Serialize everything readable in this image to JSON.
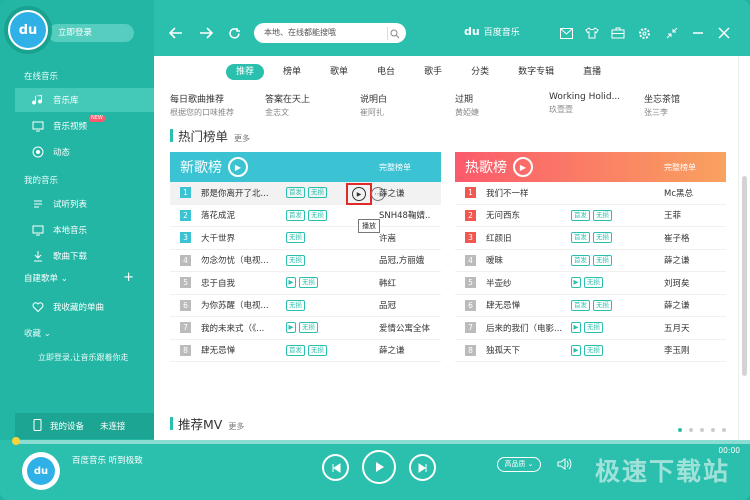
{
  "sidebar": {
    "login": "立即登录",
    "online_section": "在线音乐",
    "items": [
      {
        "label": "音乐库",
        "icon": "music-note-icon"
      },
      {
        "label": "音乐视频",
        "icon": "video-icon",
        "badge": "NEW"
      },
      {
        "label": "动态",
        "icon": "activity-icon"
      }
    ],
    "my_section": "我的音乐",
    "my_items": [
      {
        "label": "试听列表",
        "icon": "list-icon"
      },
      {
        "label": "本地音乐",
        "icon": "monitor-icon"
      },
      {
        "label": "歌曲下载",
        "icon": "download-icon"
      }
    ],
    "custom_playlist": "自建歌单",
    "fav_item": "我收藏的单曲",
    "collect_section": "收藏",
    "login_tip": "立即登录,让音乐跟着你走",
    "device": "我的设备",
    "device_status": "未连接"
  },
  "topbar": {
    "search_placeholder": "本地、在线都能搜哦",
    "brand": "百度音乐"
  },
  "main": {
    "tabs": [
      "推荐",
      "榜单",
      "歌单",
      "电台",
      "歌手",
      "分类",
      "数字专辑",
      "直播"
    ],
    "recommend": [
      {
        "title": "每日歌曲推荐",
        "sub": "根据您的口味推荐"
      },
      {
        "title": "答案在天上",
        "sub": "金志文"
      },
      {
        "title": "说明白",
        "sub": "崔阿扎"
      },
      {
        "title": "过期",
        "sub": "黄婭婕"
      },
      {
        "title": "Working Holid...",
        "sub": "玖壹壹"
      },
      {
        "title": "坐忘茶馆",
        "sub": "张三李"
      }
    ],
    "hot_charts": "热门榜单",
    "more": "更多",
    "new_chart": {
      "name": "新歌榜",
      "full": "完整榜单",
      "songs": [
        {
          "rank": "1",
          "title": "那是你离开了北...",
          "tags": [
            "首发",
            "无损"
          ],
          "artist": "薛之谦"
        },
        {
          "rank": "2",
          "title": "落花成泥",
          "tags": [
            "首发",
            "无损"
          ],
          "artist": "SNH48鞠婧..."
        },
        {
          "rank": "3",
          "title": "大千世界",
          "tags": [
            "无损"
          ],
          "artist": "许嵩"
        },
        {
          "rank": "4",
          "title": "勿念勿忧（电视...",
          "tags": [
            "无损"
          ],
          "artist": "品冠,方丽娥"
        },
        {
          "rank": "5",
          "title": "忠于自我",
          "tags": [
            "MV",
            "无损"
          ],
          "artist": "韩红"
        },
        {
          "rank": "6",
          "title": "为你苏醒（电视...",
          "tags": [
            "无损"
          ],
          "artist": "品冠"
        },
        {
          "rank": "7",
          "title": "我的未来式（《...",
          "tags": [
            "MV",
            "无损"
          ],
          "artist": "爱情公寓全体"
        },
        {
          "rank": "8",
          "title": "肆无忌惮",
          "tags": [
            "首发",
            "无损"
          ],
          "artist": "薛之谦"
        }
      ]
    },
    "hot_chart": {
      "name": "热歌榜",
      "full": "完整榜单",
      "songs": [
        {
          "rank": "1",
          "title": "我们不一样",
          "tags": [],
          "artist": "Mc黑总"
        },
        {
          "rank": "2",
          "title": "无问西东",
          "tags": [
            "首发",
            "无损"
          ],
          "artist": "王菲"
        },
        {
          "rank": "3",
          "title": "红颜旧",
          "tags": [
            "首发",
            "无损"
          ],
          "artist": "崔子格"
        },
        {
          "rank": "4",
          "title": "暧昧",
          "tags": [
            "首发",
            "无损"
          ],
          "artist": "薛之谦"
        },
        {
          "rank": "5",
          "title": "半壶纱",
          "tags": [
            "MV",
            "无损"
          ],
          "artist": "刘珂矣"
        },
        {
          "rank": "6",
          "title": "肆无忌惮",
          "tags": [
            "首发",
            "无损"
          ],
          "artist": "薛之谦"
        },
        {
          "rank": "7",
          "title": "后来的我们（电影...",
          "tags": [
            "MV",
            "无损"
          ],
          "artist": "五月天"
        },
        {
          "rank": "8",
          "title": "独孤天下",
          "tags": [
            "MV",
            "无损"
          ],
          "artist": "李玉刚"
        }
      ]
    },
    "tooltip": "播放",
    "rec_mv": "推荐MV"
  },
  "player": {
    "title": "百度音乐 听到极致",
    "time": "00:00",
    "quality": "高品质",
    "watermark": "极速下载站"
  },
  "colors": {
    "accent": "#2bbfae",
    "new_chart": "#3cc3d3",
    "hot_chart": "#f76d6a"
  }
}
